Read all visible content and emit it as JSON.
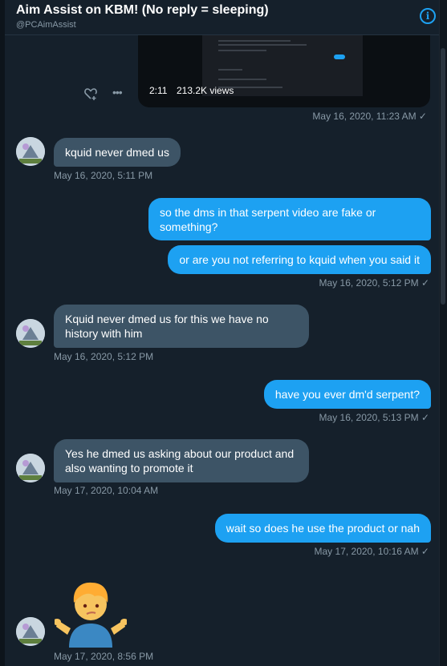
{
  "header": {
    "title": "Aim Assist on KBM! (No reply = sleeping)",
    "handle": "@PCAimAssist",
    "info_icon": "info-icon"
  },
  "video": {
    "duration": "2:11",
    "views": "213.2K views",
    "timestamp": "May 16, 2020, 11:23 AM ✓"
  },
  "messages": [
    {
      "dir": "in",
      "text": "kquid never dmed us",
      "timestamp": "May 16, 2020, 5:11 PM"
    },
    {
      "dir": "out",
      "text": "so the dms in that serpent video are fake or something?"
    },
    {
      "dir": "out",
      "text": "or are you not referring to kquid when you said it",
      "timestamp": "May 16, 2020, 5:12 PM ✓"
    },
    {
      "dir": "in",
      "text": "Kquid never dmed us for this we have no history with him",
      "timestamp": "May 16, 2020, 5:12 PM"
    },
    {
      "dir": "out",
      "text": "have you ever dm'd serpent?",
      "timestamp": "May 16, 2020, 5:13 PM ✓"
    },
    {
      "dir": "in",
      "text": "Yes he dmed us asking about our product and also wanting to promote it",
      "timestamp": "May 17, 2020, 10:04 AM"
    },
    {
      "dir": "out",
      "text": "wait so does he use the product or nah",
      "timestamp": "May 17, 2020, 10:16 AM ✓"
    },
    {
      "dir": "in",
      "emoji": "person-shrugging",
      "timestamp": "May 17, 2020, 8:56 PM"
    }
  ],
  "colors": {
    "background": "#15202b",
    "incoming_bubble": "#3d5466",
    "outgoing_bubble": "#1da1f2",
    "muted_text": "#8899a6"
  }
}
